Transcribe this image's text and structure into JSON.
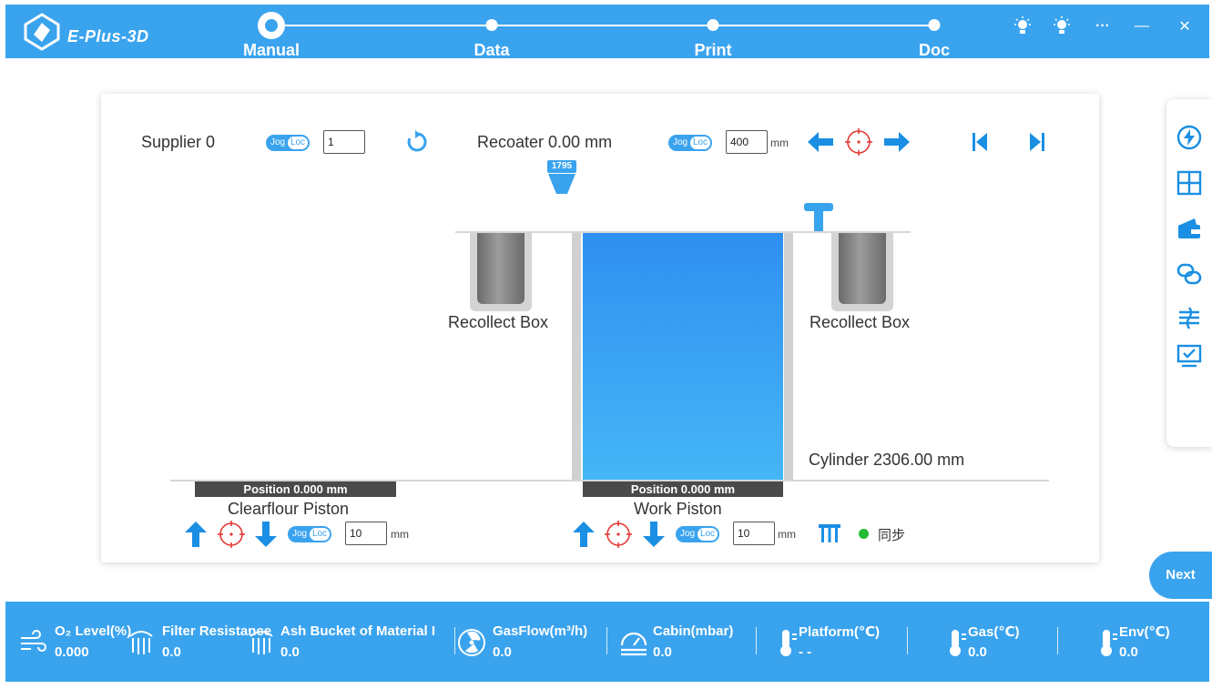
{
  "app": {
    "logo_text": "E-Plus-3D"
  },
  "steps": [
    {
      "label": "Manual",
      "active": true
    },
    {
      "label": "Data",
      "active": false
    },
    {
      "label": "Print",
      "active": false
    },
    {
      "label": "Doc",
      "active": false
    }
  ],
  "window": {
    "more": "···",
    "minimize": "—",
    "close": "✕"
  },
  "controls": {
    "supplier_label": "Supplier 0",
    "supplier_value": "1",
    "recoater_label": "Recoater 0.00 mm",
    "recoater_value": "400",
    "recoater_unit": "mm",
    "toggle_jog": "Jog",
    "toggle_loc": "Loc",
    "marker_value": "1795"
  },
  "diagram": {
    "recollect_left": "Recollect Box",
    "recollect_right": "Recollect Box",
    "cylinder_label": "Cylinder 2306.00 mm",
    "clearflour_position": "Position  0.000 mm",
    "clearflour_label": "Clearflour Piston",
    "clearflour_value": "10",
    "clearflour_unit": "mm",
    "work_position": "Position  0.000 mm",
    "work_label": "Work Piston",
    "work_value": "10",
    "work_unit": "mm",
    "sync_label": "同步"
  },
  "next_label": "Next",
  "status": [
    {
      "label": "O₂ Level(%)",
      "value": "0.000",
      "icon": "wind-icon"
    },
    {
      "label": "Filter Resistance(k",
      "value": "0.0",
      "icon": "filter-icon"
    },
    {
      "label": "Ash Bucket of Material I",
      "value": "0.0",
      "icon": "ash-bucket-icon"
    },
    {
      "label": "GasFlow(m³/h)",
      "value": "0.0",
      "icon": "radiation-icon"
    },
    {
      "label": "Cabin(mbar)",
      "value": "0.0",
      "icon": "gauge-icon"
    },
    {
      "label": "Platform(℃)",
      "value": "- -",
      "icon": "thermometer-icon"
    },
    {
      "label": "Gas(℃)",
      "value": "0.0",
      "icon": "thermometer-icon"
    },
    {
      "label": "Env(℃)",
      "value": "0.0",
      "icon": "thermometer-icon"
    }
  ],
  "colors": {
    "accent": "#3aa3ee",
    "target": "#e53935",
    "sync": "#22bb33",
    "piston_bar": "#4a4a4a"
  }
}
